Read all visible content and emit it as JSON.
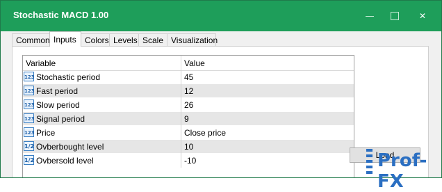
{
  "window": {
    "title": "Stochastic MACD 1.00",
    "minimize_glyph": "",
    "maximize_glyph": "",
    "close_glyph": "✕",
    "title_bar_color": "#1e9e5a"
  },
  "tabs": [
    {
      "label": "Common",
      "active": false
    },
    {
      "label": "Inputs",
      "active": true
    },
    {
      "label": "Colors",
      "active": false
    },
    {
      "label": "Levels",
      "active": false
    },
    {
      "label": "Scale",
      "active": false
    },
    {
      "label": "Visualization",
      "active": false
    }
  ],
  "grid": {
    "columns": {
      "variable": "Variable",
      "value": "Value"
    },
    "rows": [
      {
        "icon": "integer-icon",
        "badge": "123",
        "name": "Stochastic period",
        "value": "45"
      },
      {
        "icon": "integer-icon",
        "badge": "123",
        "name": "Fast period",
        "value": "12"
      },
      {
        "icon": "integer-icon",
        "badge": "123",
        "name": "Slow period",
        "value": "26"
      },
      {
        "icon": "integer-icon",
        "badge": "123",
        "name": "Signal period",
        "value": "9"
      },
      {
        "icon": "integer-icon",
        "badge": "123",
        "name": "Price",
        "value": "Close price"
      },
      {
        "icon": "double-icon",
        "badge": "1/2",
        "name": "Ovberbought level",
        "value": "10"
      },
      {
        "icon": "double-icon",
        "badge": "1/2",
        "name": "Ovbersold level",
        "value": "-10"
      }
    ]
  },
  "buttons": {
    "load_label": "Load"
  },
  "watermark": {
    "text": "Prof-FX",
    "color": "#2b6fc2"
  }
}
